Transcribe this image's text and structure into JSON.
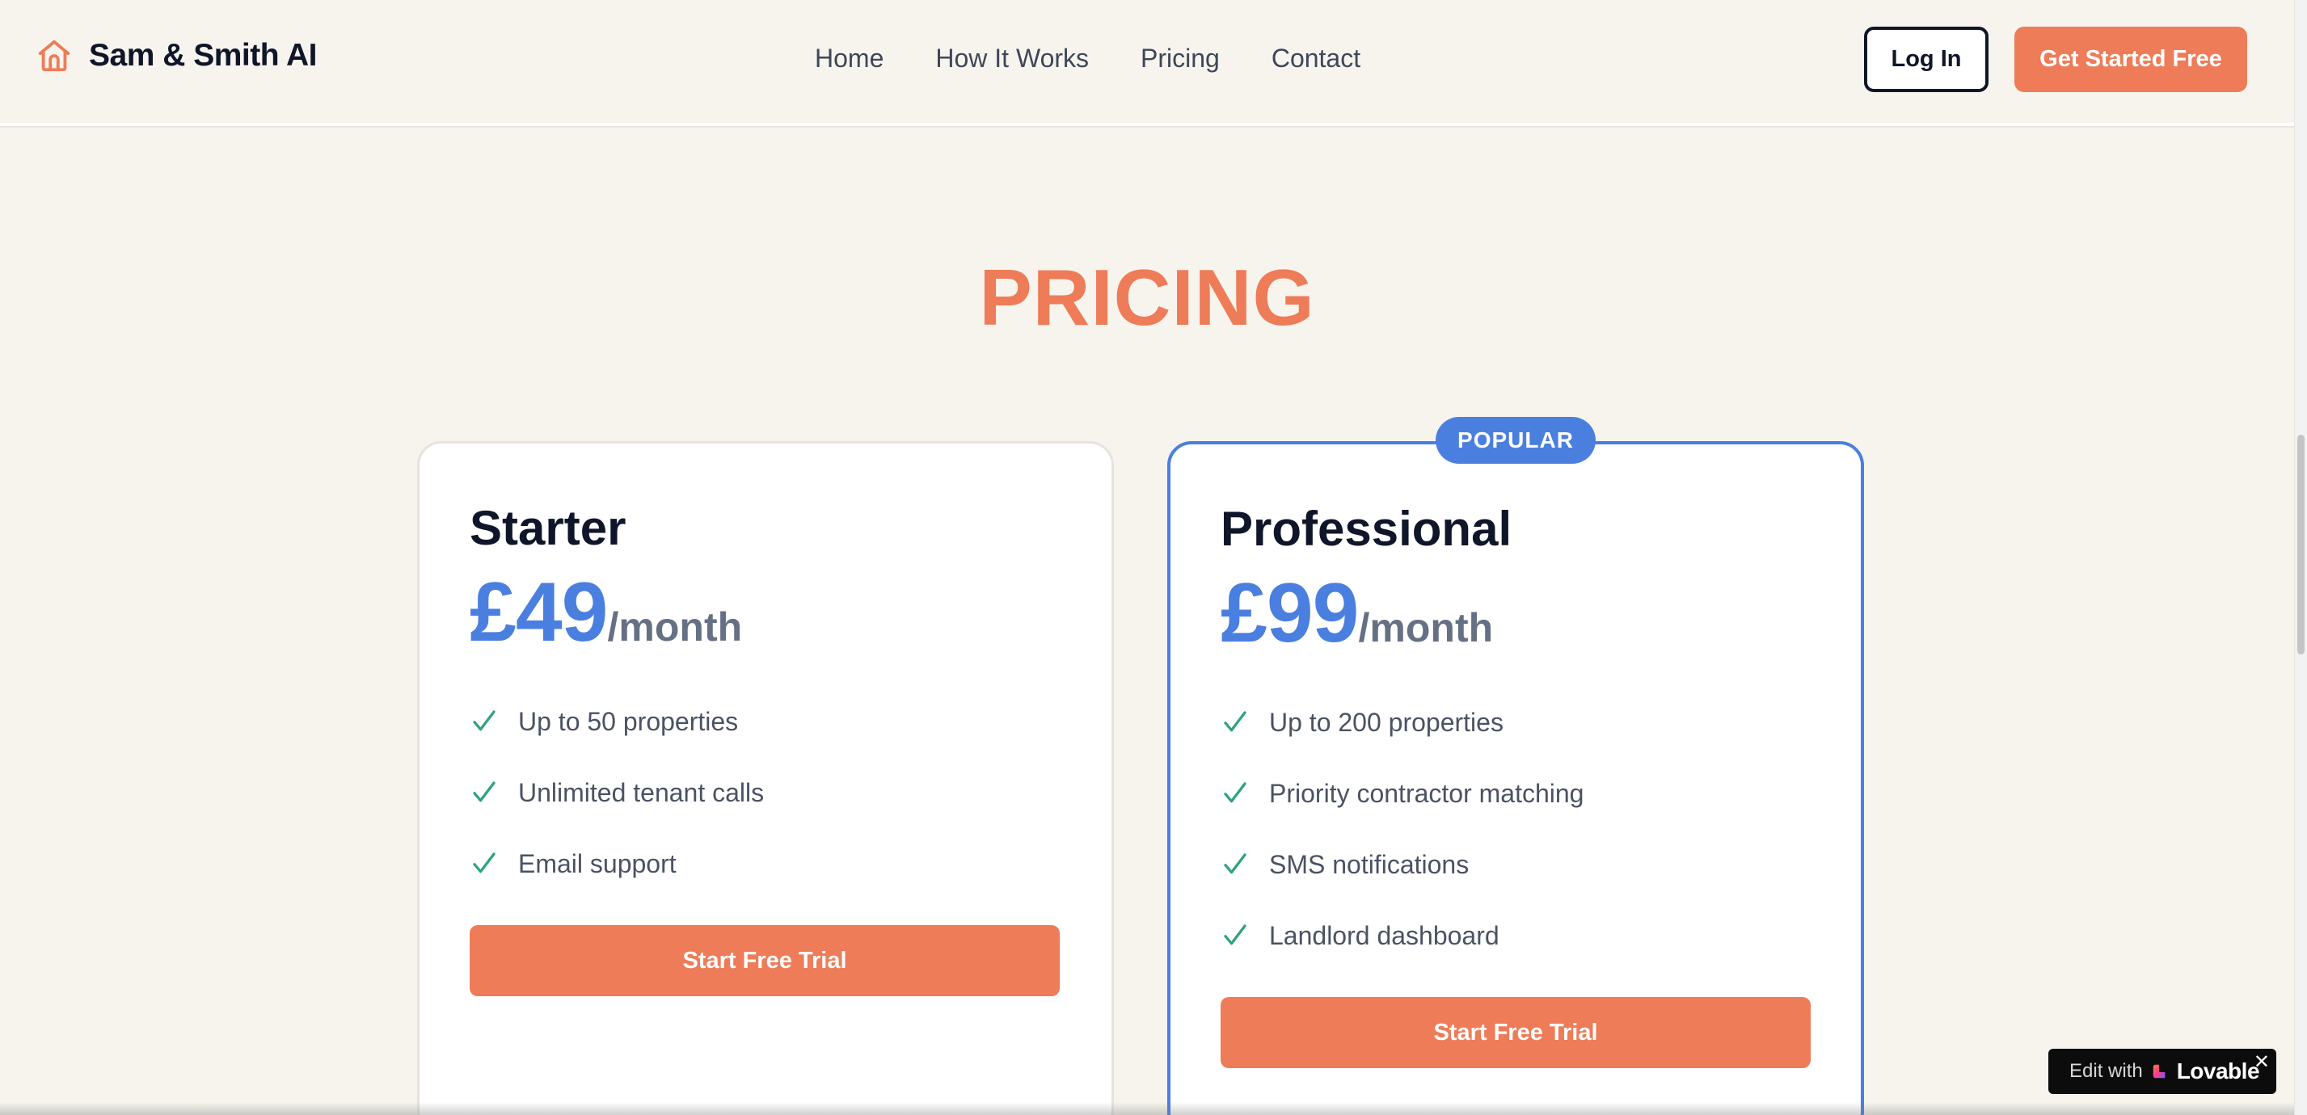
{
  "header": {
    "brand_name": "Sam & Smith AI",
    "brand_icon": "house-icon",
    "nav": [
      "Home",
      "How It Works",
      "Pricing",
      "Contact"
    ],
    "login_label": "Log In",
    "cta_label": "Get Started Free"
  },
  "section": {
    "title": "PRICING"
  },
  "plans": [
    {
      "name": "Starter",
      "price": "£49",
      "period": "/month",
      "features": [
        "Up to 50 properties",
        "Unlimited tenant calls",
        "Email support"
      ],
      "button_label": "Start Free Trial"
    },
    {
      "name": "Professional",
      "badge": "POPULAR",
      "price": "£99",
      "period": "/month",
      "features": [
        "Up to 200 properties",
        "Priority contractor matching",
        "SMS notifications",
        "Landlord dashboard"
      ],
      "button_label": "Start Free Trial"
    }
  ],
  "lovable": {
    "edit_label": "Edit with",
    "brand": "Lovable",
    "close": "✕"
  },
  "colors": {
    "accent": "#ee7c58",
    "primary": "#4a7fe0",
    "check": "#2fa37a",
    "background": "#f7f4ee"
  }
}
